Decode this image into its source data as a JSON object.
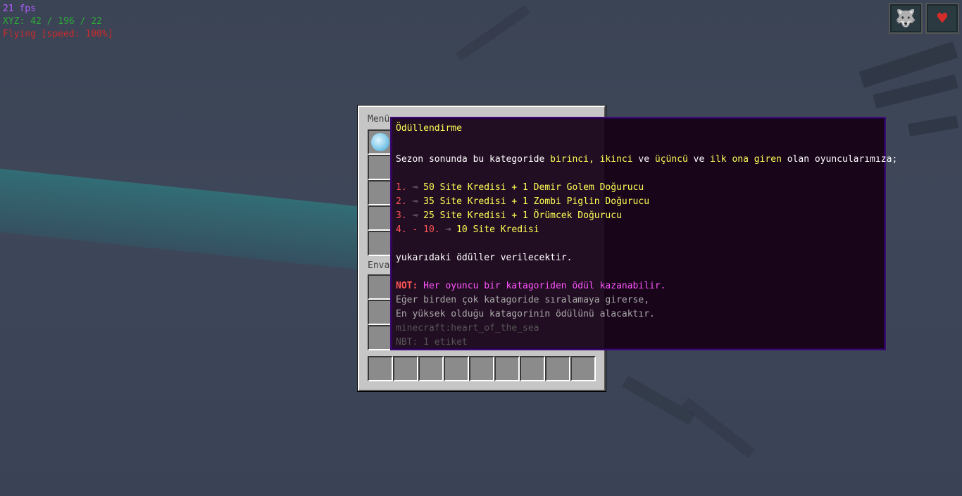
{
  "hud": {
    "fps": "21 fps",
    "xyz": "XYZ: 42 / 196 / 22",
    "flying": "Flying [speed: 100%]"
  },
  "effects": [
    {
      "name": "wolf-effect",
      "icon": "wolf-icon",
      "glyph": "🐺"
    },
    {
      "name": "health-boost-effect",
      "icon": "heart-icon",
      "glyph": "♥"
    }
  ],
  "window": {
    "menu_title": "Menü",
    "inventory_title": "Envan"
  },
  "tooltip": {
    "title": "Ödüllendirme",
    "intro_a": "Sezon sonunda bu kategoride ",
    "intro_b": "birinci, ikinci",
    "intro_c": " ve ",
    "intro_d": "üçüncü",
    "intro_e": " ve ",
    "intro_f": "ilk ona giren",
    "intro_g": " olan oyuncularımıza;",
    "rewards": [
      {
        "rank": "1.",
        "text": "50 Site Kredisi + 1 Demir Golem Doğurucu"
      },
      {
        "rank": "2.",
        "text": "35 Site Kredisi + 1 Zombi Piglin Doğurucu"
      },
      {
        "rank": "3.",
        "text": "25 Site Kredisi + 1 Örümcek Doğurucu"
      },
      {
        "rank": "4. - 10.",
        "text": "10 Site Kredisi"
      }
    ],
    "arrow": "⊸",
    "outro": "yukarıdaki ödüller verilecektir.",
    "note_label": "NOT:",
    "note_text": " Her oyuncu bir katagoriden ödül kazanabilir.",
    "line2": "Eğer birden çok katagoride sıralamaya girerse,",
    "line3": "En yüksek olduğu katagorinin ödülünü alacaktır.",
    "item_id": "minecraft:heart_of_the_sea",
    "nbt": "NBT: 1 etiket"
  },
  "colors": {
    "title": "#ffff55",
    "rank": "#ff5555",
    "reward": "#ffff55",
    "note": "#ff55ff"
  }
}
